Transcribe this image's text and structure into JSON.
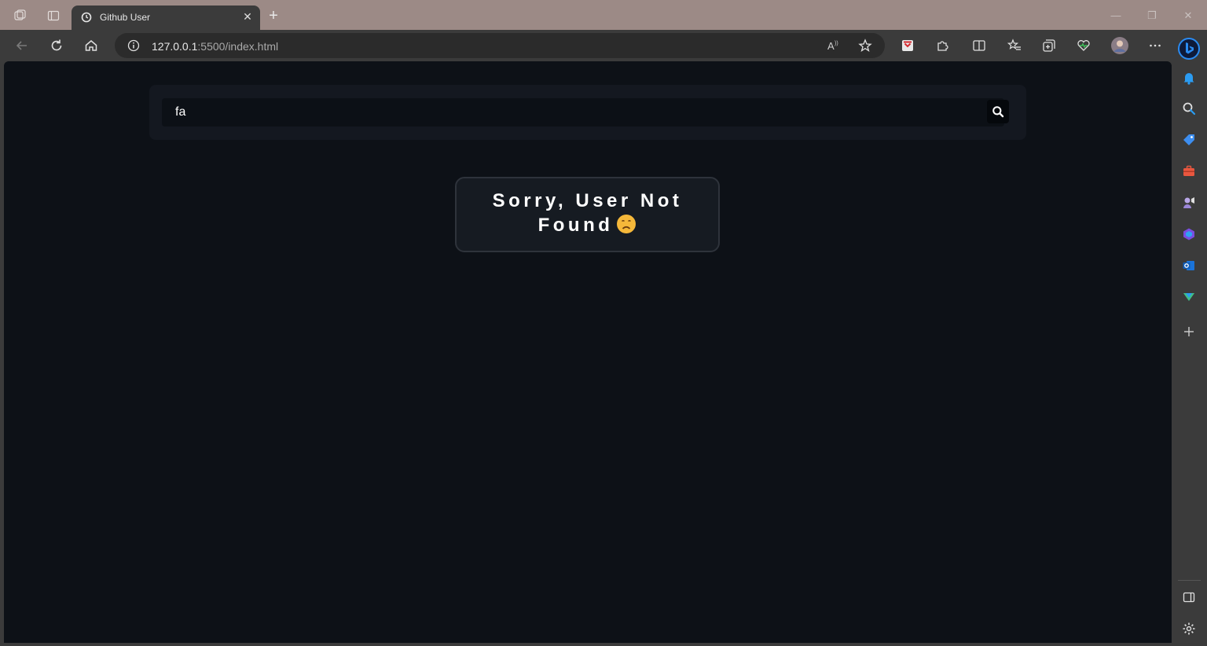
{
  "browser": {
    "tab": {
      "title": "Github User"
    },
    "address": {
      "host": "127.0.0.1",
      "rest": ":5500/index.html"
    }
  },
  "page": {
    "search": {
      "value": "fa"
    },
    "error_message": "Sorry, User Not Found"
  },
  "colors": {
    "page_bg": "#0d1117",
    "card_bg": "#161b22",
    "chrome_bg": "#3b3b3b",
    "titlebar_bg": "#9c8a86"
  }
}
